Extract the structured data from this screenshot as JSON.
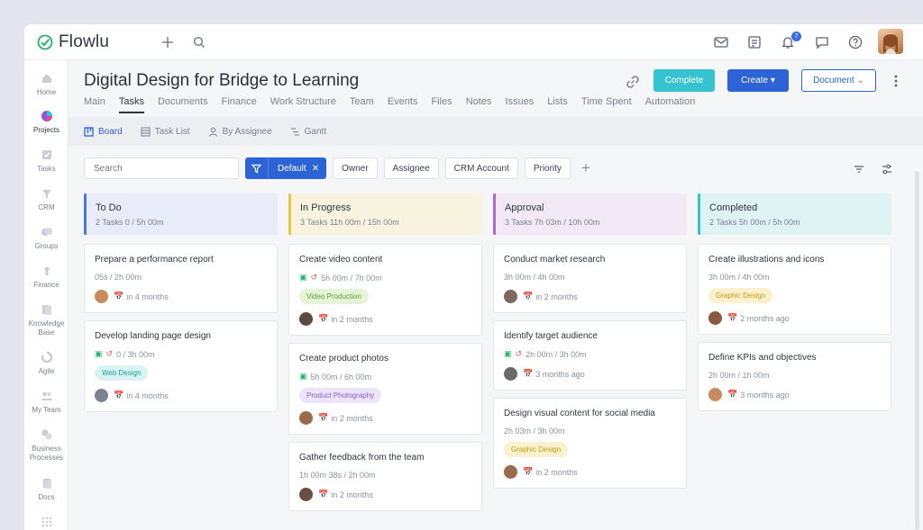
{
  "app": {
    "name": "Flowlu",
    "notification_count": "7"
  },
  "sidebar": {
    "items": [
      {
        "label": "Home"
      },
      {
        "label": "Projects"
      },
      {
        "label": "Tasks"
      },
      {
        "label": "CRM"
      },
      {
        "label": "Groups"
      },
      {
        "label": "Finance"
      },
      {
        "label": "Knowledge",
        "label2": "Base"
      },
      {
        "label": "Agile"
      },
      {
        "label": "My Team"
      },
      {
        "label": "Business",
        "label2": "Processes"
      },
      {
        "label": "Docs"
      }
    ]
  },
  "project": {
    "title": "Digital Design for Bridge to Learning",
    "tabs": [
      "Main",
      "Tasks",
      "Documents",
      "Finance",
      "Work Structure",
      "Team",
      "Events",
      "Files",
      "Notes",
      "Issues",
      "Lists",
      "Time Spent",
      "Automation"
    ],
    "complete_label": "Complete",
    "create_label": "Create",
    "document_label": "Document"
  },
  "views": [
    "Board",
    "Task List",
    "By Assignee",
    "Gantt"
  ],
  "filters": {
    "search_placeholder": "Search",
    "default_label": "Default",
    "chips": [
      "Owner",
      "Assignee",
      "CRM Account",
      "Priority"
    ]
  },
  "colors": {
    "accent": "#2c64d8",
    "complete": "#35c3cf"
  },
  "columns": [
    {
      "title": "To Do",
      "meta": "2 Tasks   0 / 5h 00m",
      "cards": [
        {
          "title": "Prepare a performance report",
          "time": "05s / 2h 00m",
          "due": "in 4 months"
        },
        {
          "title": "Develop landing page design",
          "time": "0 / 3h 00m",
          "tag": "Web Design",
          "due": "in 4 months"
        }
      ]
    },
    {
      "title": "In Progress",
      "meta": "3 Tasks   11h 00m / 15h 00m",
      "cards": [
        {
          "title": "Create video content",
          "time": "5h 00m / 7h 00m",
          "tag": "Video Production",
          "due": "in 2 months"
        },
        {
          "title": "Create product photos",
          "time": "5h 00m / 6h 00m",
          "tag": "Product Photography",
          "due": "in 2 months"
        },
        {
          "title": "Gather feedback from the team",
          "time": "1h 00m 38s / 2h 00m",
          "due": "in 2 months"
        }
      ]
    },
    {
      "title": "Approval",
      "meta": "3 Tasks   7h 03m / 10h 00m",
      "cards": [
        {
          "title": "Conduct market research",
          "time": "3h 00m / 4h 00m",
          "due": "in 2 months"
        },
        {
          "title": "Identify target audience",
          "time": "2h 00m / 3h 00m",
          "due": "3 months ago"
        },
        {
          "title": "Design visual content for social media",
          "time": "2h 03m / 3h 00m",
          "tag": "Graphic Design",
          "due": "in 2 months"
        }
      ]
    },
    {
      "title": "Completed",
      "meta": "2 Tasks   5h 00m / 5h 00m",
      "cards": [
        {
          "title": "Create illustrations and icons",
          "time": "3h 00m / 4h 00m",
          "tag": "Graphic Design",
          "due": "2 months ago"
        },
        {
          "title": "Define KPIs and objectives",
          "time": "2h 00m / 1h 00m",
          "due": "3 months ago"
        }
      ]
    }
  ]
}
